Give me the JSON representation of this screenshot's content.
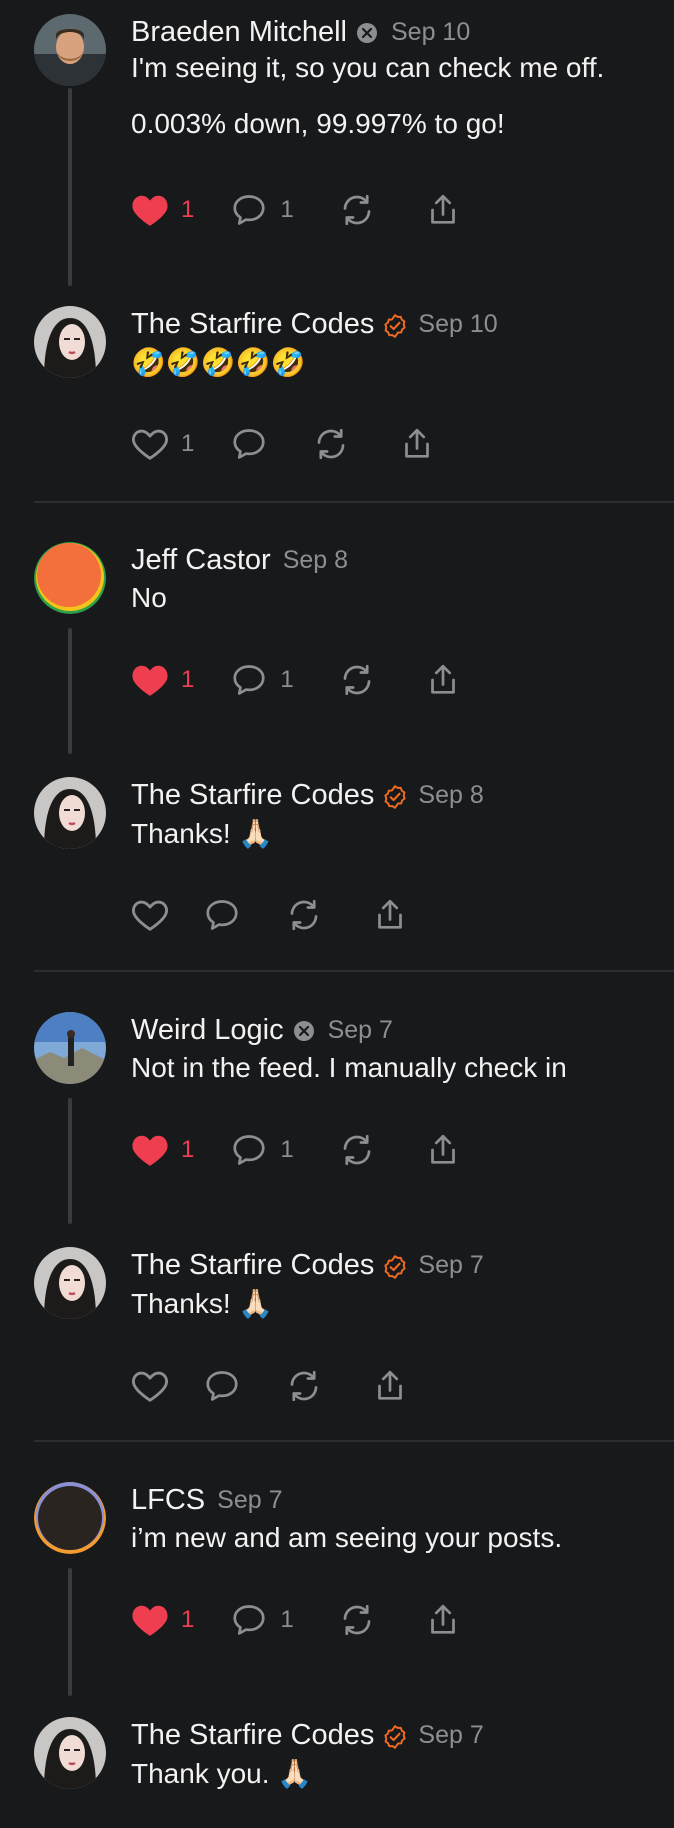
{
  "posts": [
    {
      "name": "Braeden Mitchell",
      "badge": "muted-badge-icon",
      "date": "Sep 10",
      "lines": [
        "I'm seeing it, so you can check me off.",
        "0.003% down, 99.997% to go!"
      ],
      "liked": true,
      "likes": "1",
      "replies": "1",
      "avatar": "avatar-photo-man-beard"
    },
    {
      "name": "The Starfire Codes",
      "badge": "verified-badge-icon",
      "date": "Sep 10",
      "lines": [
        "🤣🤣🤣🤣🤣"
      ],
      "liked": false,
      "likes": "1",
      "replies": "",
      "avatar": "avatar-photo-woman"
    },
    {
      "name": "Jeff Castor",
      "badge": "",
      "date": "Sep 8",
      "lines": [
        "No"
      ],
      "liked": true,
      "likes": "1",
      "replies": "1",
      "avatar": "avatar-orange-circle"
    },
    {
      "name": "The Starfire Codes",
      "badge": "verified-badge-icon",
      "date": "Sep 8",
      "lines": [
        "Thanks! 🙏🏻"
      ],
      "liked": false,
      "likes": "",
      "replies": "",
      "avatar": "avatar-photo-woman"
    },
    {
      "name": "Weird Logic",
      "badge": "muted-badge-icon",
      "date": "Sep 7",
      "lines": [
        "Not in the feed. I manually check in"
      ],
      "liked": true,
      "likes": "1",
      "replies": "1",
      "avatar": "avatar-photo-landscape"
    },
    {
      "name": "The Starfire Codes",
      "badge": "verified-badge-icon",
      "date": "Sep 7",
      "lines": [
        "Thanks! 🙏🏻"
      ],
      "liked": false,
      "likes": "",
      "replies": "",
      "avatar": "avatar-photo-woman"
    },
    {
      "name": "LFCS",
      "badge": "",
      "date": "Sep 7",
      "lines": [
        "i’m new and am seeing your posts."
      ],
      "liked": true,
      "likes": "1",
      "replies": "1",
      "avatar": "avatar-dark-circle"
    },
    {
      "name": "The Starfire Codes",
      "badge": "verified-badge-icon",
      "date": "Sep 7",
      "lines": [
        "Thank you. 🙏🏻"
      ],
      "liked": false,
      "likes": "",
      "replies": "",
      "avatar": "avatar-photo-woman"
    }
  ],
  "colors": {
    "background": "#18191b",
    "like_red": "#ef3e4f",
    "muted": "#8d8e92",
    "verified": "#f26b21",
    "text": "#f2f2f2"
  }
}
